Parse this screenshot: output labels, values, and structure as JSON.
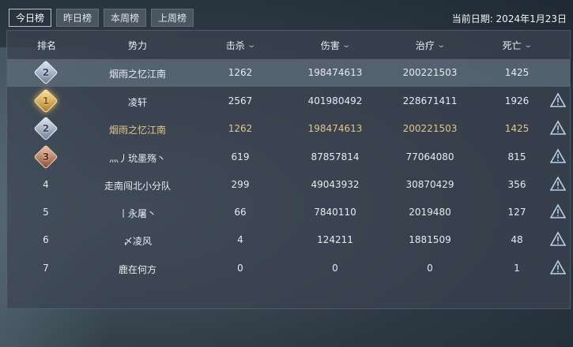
{
  "tabs": [
    "今日榜",
    "昨日榜",
    "本周榜",
    "上周榜"
  ],
  "date_label": "当前日期: 2024年1月23日",
  "columns": {
    "rank": "排名",
    "faction": "势力",
    "kills": "击杀",
    "damage": "伤害",
    "heal": "治疗",
    "deaths": "死亡"
  },
  "rows": [
    {
      "rank": "2",
      "faction": "烟雨之忆江南",
      "kills": "1262",
      "damage": "198474613",
      "heal": "200221503",
      "deaths": "1425"
    },
    {
      "rank": "1",
      "faction": "凌轩",
      "kills": "2567",
      "damage": "401980492",
      "heal": "228671411",
      "deaths": "1926"
    },
    {
      "rank": "2",
      "faction": "烟雨之忆江南",
      "kills": "1262",
      "damage": "198474613",
      "heal": "200221503",
      "deaths": "1425"
    },
    {
      "rank": "3",
      "faction": "灬丿玧墨殇丶",
      "kills": "619",
      "damage": "87857814",
      "heal": "77064080",
      "deaths": "815"
    },
    {
      "rank": "4",
      "faction": "走南闯北小分队",
      "kills": "299",
      "damage": "49043932",
      "heal": "30870429",
      "deaths": "356"
    },
    {
      "rank": "5",
      "faction": "丨永屠丶",
      "kills": "66",
      "damage": "7840110",
      "heal": "2019480",
      "deaths": "127"
    },
    {
      "rank": "6",
      "faction": "〆凌风",
      "kills": "4",
      "damage": "124211",
      "heal": "1881509",
      "deaths": "48"
    },
    {
      "rank": "7",
      "faction": "鹿在何方",
      "kills": "0",
      "damage": "0",
      "heal": "0",
      "deaths": "1"
    }
  ],
  "colors": {
    "highlight_text": "#e2c58a",
    "accent": "#b6c4cf"
  }
}
